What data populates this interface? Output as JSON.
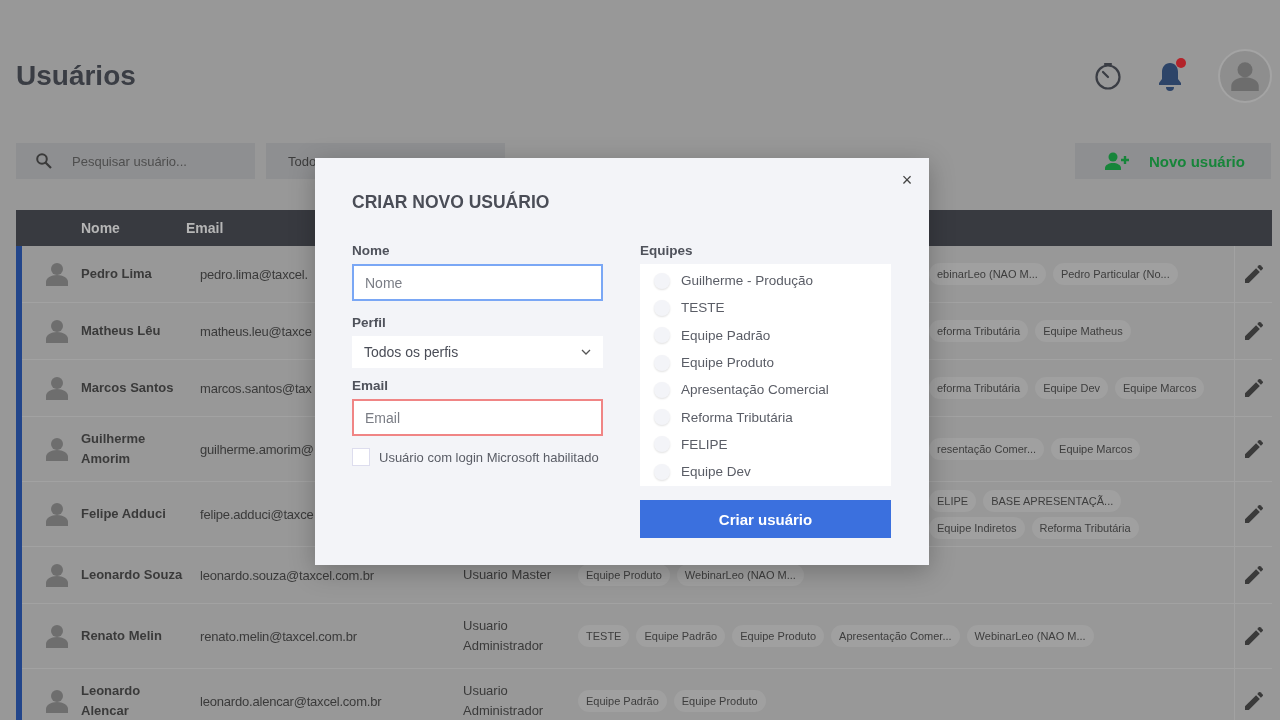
{
  "page": {
    "title": "Usuários"
  },
  "header": {
    "notification_unread": true
  },
  "toolbar": {
    "search_placeholder": "Pesquisar usuário...",
    "profile_filter": "Todo",
    "new_user_button": "Novo usuário"
  },
  "table": {
    "columns": [
      "Nome",
      "Email"
    ],
    "rows": [
      {
        "name": "Pedro Lima",
        "email": "pedro.lima@taxcel.",
        "tag_lines": [
          [
            "ebinarLeo (NAO M...",
            "Pedro Particular (No..."
          ]
        ]
      },
      {
        "name": "Matheus Lêu",
        "email": "matheus.leu@taxce",
        "tag_lines": [
          [
            "eforma Tributária",
            "Equipe Matheus"
          ]
        ]
      },
      {
        "name": "Marcos Santos",
        "email": "marcos.santos@tax",
        "tag_lines": [
          [
            "eforma Tributária",
            "Equipe Dev",
            "Equipe Marcos"
          ]
        ]
      },
      {
        "name": "Guilherme Amorim",
        "email": "guilherme.amorim@",
        "tag_lines": [
          [
            "resentação Comer...",
            "Equipe Marcos"
          ]
        ]
      },
      {
        "name": "Felipe Adduci",
        "email": "felipe.adduci@taxce",
        "tag_lines": [
          [
            "ELIPE",
            "BASE APRESENTAÇÃ..."
          ],
          [
            "Equipe Indiretos",
            "Reforma Tributária"
          ]
        ]
      },
      {
        "name": "Leonardo Souza",
        "email": "leonardo.souza@taxcel.com.br",
        "role": "Usuario Master",
        "tag_lines": [
          [
            "Equipe Produto",
            "WebinarLeo (NAO M..."
          ]
        ]
      },
      {
        "name": "Renato Melin",
        "email": "renato.melin@taxcel.com.br",
        "role": "Usuario Administrador",
        "tag_lines": [
          [
            "TESTE",
            "Equipe Padrão",
            "Equipe Produto",
            "Apresentação Comer...",
            "WebinarLeo (NAO M..."
          ]
        ]
      },
      {
        "name": "Leonardo Alencar",
        "email": "leonardo.alencar@taxcel.com.br",
        "role": "Usuario Administrador",
        "tag_lines": [
          [
            "Equipe Padrão",
            "Equipe Produto"
          ]
        ]
      }
    ]
  },
  "modal": {
    "title": "CRIAR NOVO USUÁRIO",
    "close_button": "×",
    "name_label": "Nome",
    "name_placeholder": "Nome",
    "name_focused": true,
    "profile_label": "Perfil",
    "profile_value": "Todos os perfis",
    "email_label": "Email",
    "email_placeholder": "Email",
    "email_invalid": true,
    "microsoft_login": {
      "label": "Usuário com login Microsoft habilitado",
      "checked": false
    },
    "teams_label": "Equipes",
    "teams": [
      {
        "label": "Guilherme - Produção",
        "checked": false
      },
      {
        "label": "TESTE",
        "checked": false
      },
      {
        "label": "Equipe Padrão",
        "checked": false
      },
      {
        "label": "Equipe Produto",
        "checked": false
      },
      {
        "label": "Apresentação Comercial",
        "checked": false
      },
      {
        "label": "Reforma Tributária",
        "checked": false
      },
      {
        "label": "FELIPE",
        "checked": false
      },
      {
        "label": "Equipe Dev",
        "checked": false
      }
    ],
    "submit_button": "Criar usuário"
  }
}
